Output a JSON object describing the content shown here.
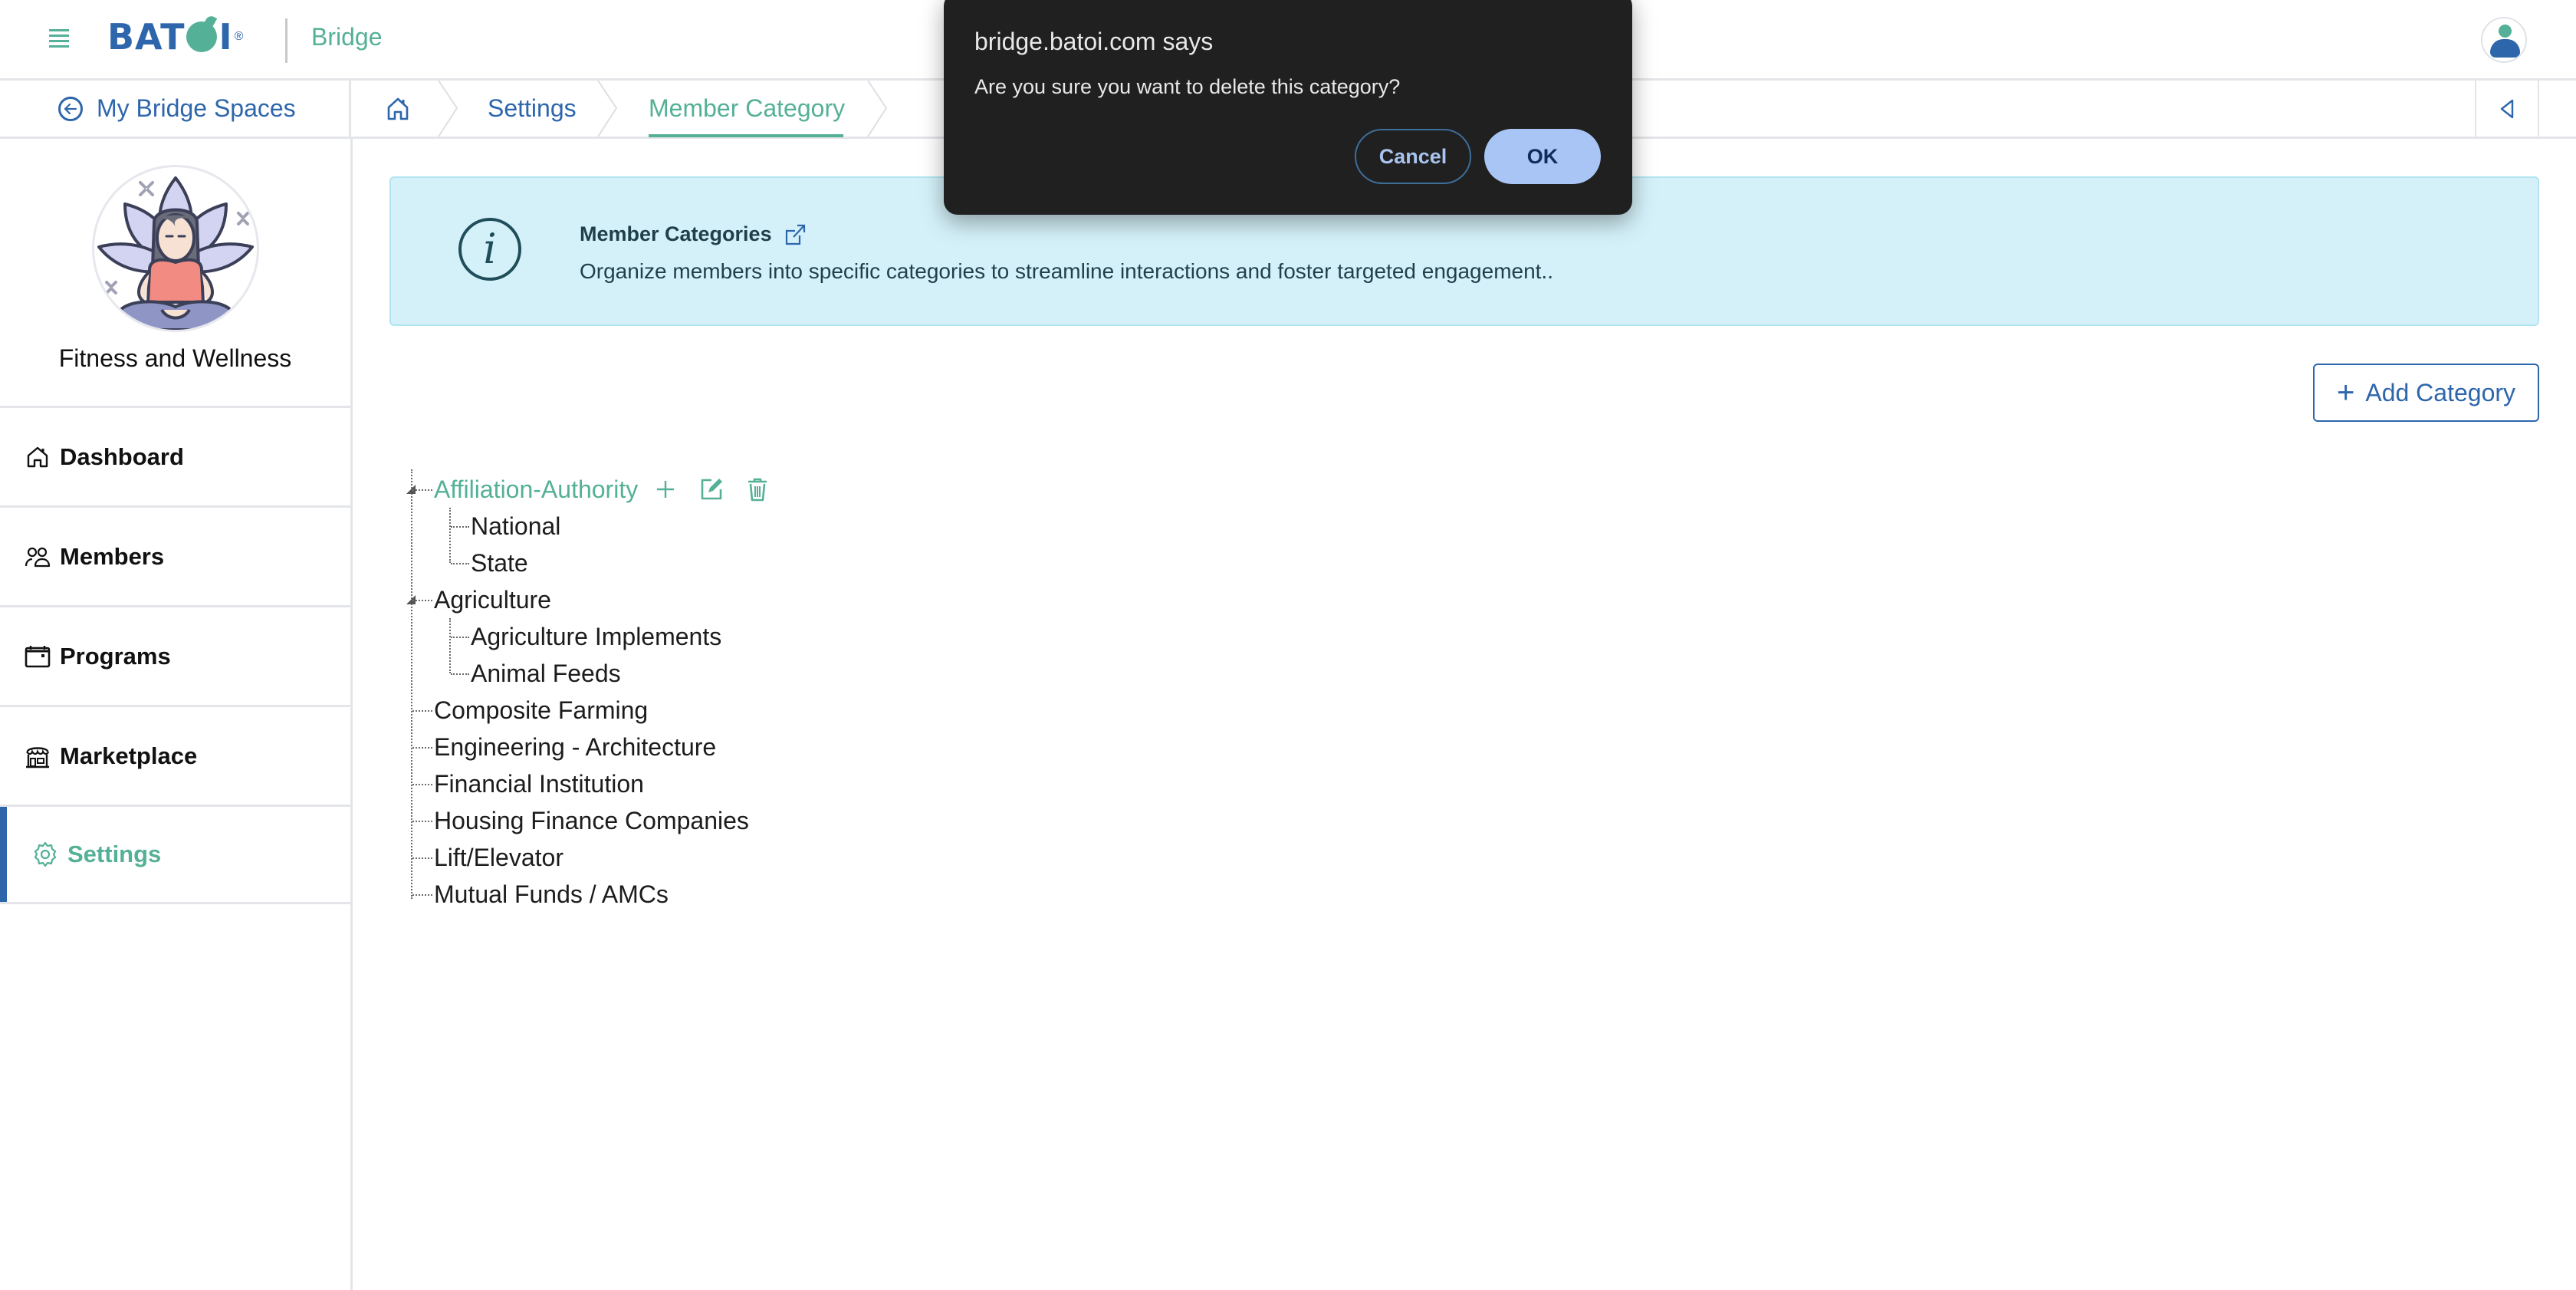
{
  "header": {
    "logo_text": "BATOI",
    "logo_reg": "®",
    "app_name": "Bridge"
  },
  "breadcrumb": {
    "back_label": "My Bridge Spaces",
    "items": [
      "Settings",
      "Member Category"
    ]
  },
  "sidebar": {
    "space_name": "Fitness and Wellness",
    "items": [
      {
        "label": "Dashboard",
        "icon": "home-icon",
        "active": false
      },
      {
        "label": "Members",
        "icon": "users-icon",
        "active": false
      },
      {
        "label": "Programs",
        "icon": "calendar-icon",
        "active": false
      },
      {
        "label": "Marketplace",
        "icon": "store-icon",
        "active": false
      },
      {
        "label": "Settings",
        "icon": "gear-icon",
        "active": true
      }
    ]
  },
  "banner": {
    "title": "Member Categories",
    "description": "Organize members into specific categories to streamline interactions and foster targeted engagement.."
  },
  "actions": {
    "add_category_label": "Add Category"
  },
  "tree": [
    {
      "label": "Affiliation-Authority",
      "selected": true,
      "expanded": true,
      "children": [
        "National",
        "State"
      ]
    },
    {
      "label": "Agriculture",
      "selected": false,
      "expanded": true,
      "children": [
        "Agriculture Implements",
        "Animal Feeds"
      ]
    },
    {
      "label": "Composite Farming",
      "selected": false,
      "children": []
    },
    {
      "label": "Engineering - Architecture",
      "selected": false,
      "children": []
    },
    {
      "label": "Financial Institution",
      "selected": false,
      "children": []
    },
    {
      "label": "Housing Finance Companies",
      "selected": false,
      "children": []
    },
    {
      "label": "Lift/Elevator",
      "selected": false,
      "children": []
    },
    {
      "label": "Mutual Funds / AMCs",
      "selected": false,
      "children": []
    }
  ],
  "dialog": {
    "title": "bridge.batoi.com says",
    "message": "Are you sure you want to delete this category?",
    "cancel_label": "Cancel",
    "ok_label": "OK"
  },
  "colors": {
    "brand_blue": "#2e66ac",
    "brand_green": "#54b096",
    "banner_bg": "#d4f1f9",
    "dialog_bg": "#202020",
    "ok_button": "#a8c5f5"
  }
}
